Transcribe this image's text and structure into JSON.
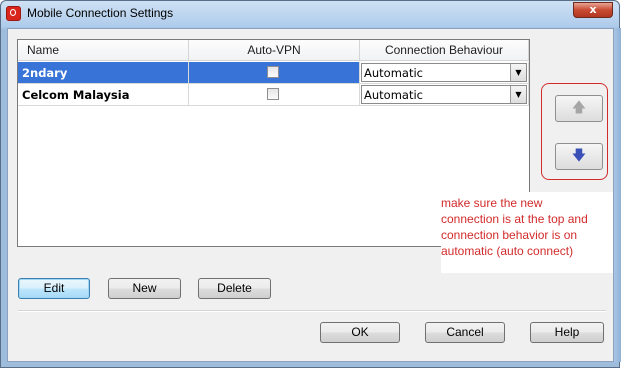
{
  "window": {
    "title": "Mobile Connection Settings",
    "close_label": "x"
  },
  "grid": {
    "columns": [
      "Name",
      "Auto-VPN",
      "Connection Behaviour"
    ],
    "rows": [
      {
        "name": "2ndary",
        "auto_vpn": false,
        "behaviour": "Automatic",
        "selected": true
      },
      {
        "name": "Celcom Malaysia",
        "auto_vpn": false,
        "behaviour": "Automatic",
        "selected": false
      }
    ]
  },
  "move_buttons": {
    "up_icon": "arrow-up-icon",
    "down_icon": "arrow-down-icon",
    "up_glyph": "🡅",
    "down_glyph": "🡇"
  },
  "annotation": {
    "lines": [
      "make sure the new",
      "connection is at the top and",
      "connection behavior is on",
      "automatic (auto connect)"
    ],
    "color": "#d32b2b"
  },
  "actions": {
    "edit": "Edit",
    "new": "New",
    "delete": "Delete"
  },
  "dialog_buttons": {
    "ok": "OK",
    "cancel": "Cancel",
    "help": "Help"
  },
  "colors": {
    "selection": "#3874d8",
    "highlight_border": "#d32b2b"
  }
}
